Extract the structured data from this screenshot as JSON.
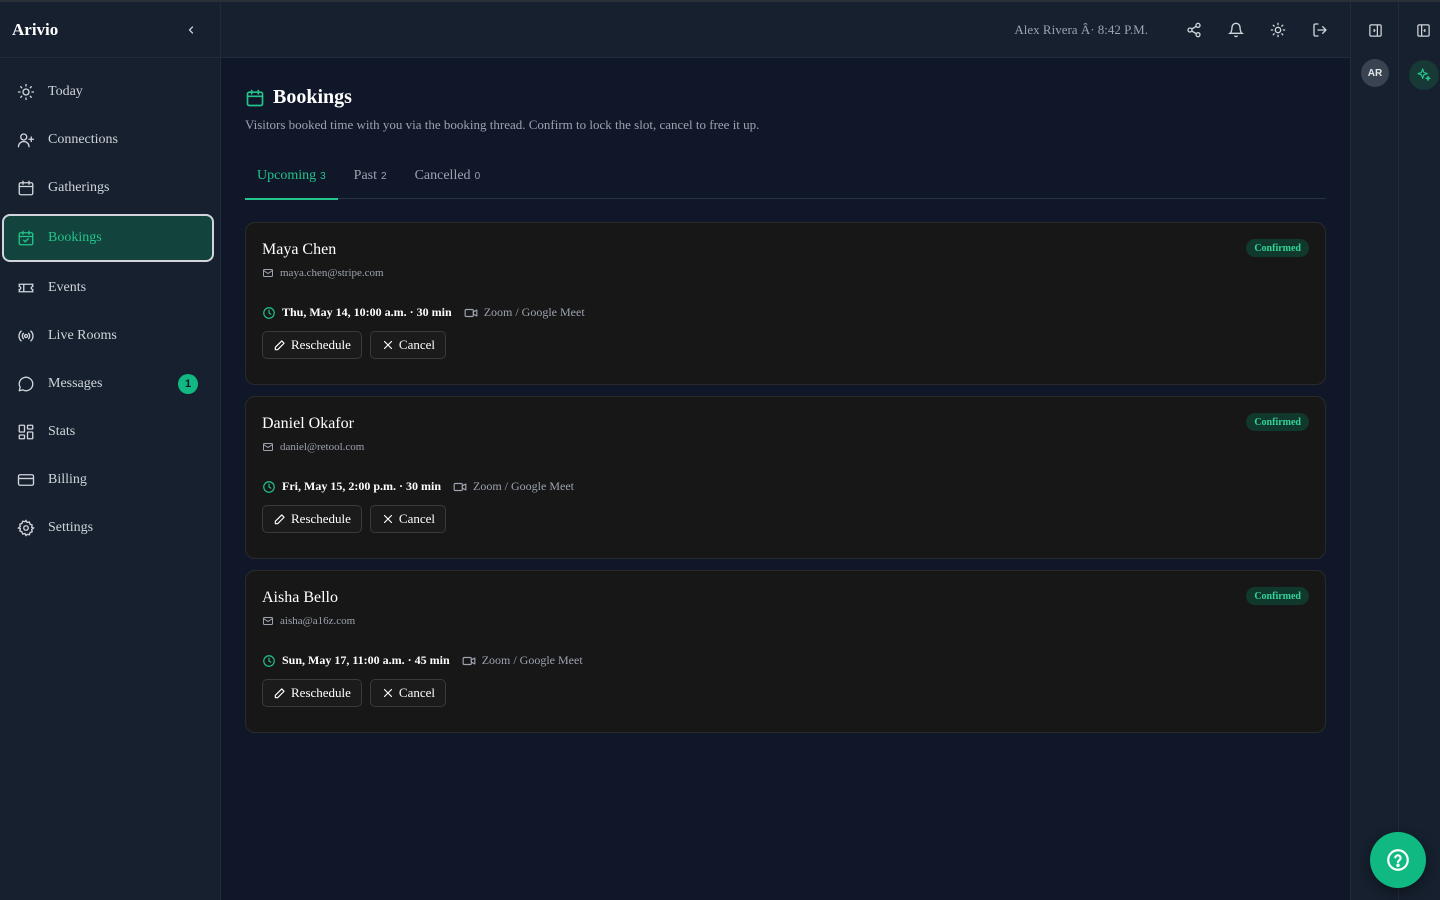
{
  "app": {
    "brand": "Arivio"
  },
  "sidebar": {
    "items": [
      {
        "label": "Today",
        "icon": "sun-icon"
      },
      {
        "label": "Connections",
        "icon": "user-plus-icon"
      },
      {
        "label": "Gatherings",
        "icon": "calendar-icon"
      },
      {
        "label": "Bookings",
        "icon": "calendar-check-icon",
        "active": true
      },
      {
        "label": "Events",
        "icon": "ticket-icon"
      },
      {
        "label": "Live Rooms",
        "icon": "broadcast-icon"
      },
      {
        "label": "Messages",
        "icon": "chat-bubble-icon",
        "badge": "1"
      },
      {
        "label": "Stats",
        "icon": "grid-icon"
      },
      {
        "label": "Billing",
        "icon": "credit-card-icon"
      },
      {
        "label": "Settings",
        "icon": "gear-icon"
      }
    ]
  },
  "topbar": {
    "user_info": "Alex Rivera Â· 8:42 P.M."
  },
  "rail": {
    "avatar_initials": "AR"
  },
  "page": {
    "title": "Bookings",
    "subtitle": "Visitors booked time with you via the booking thread. Confirm to lock the slot, cancel to free it up."
  },
  "tabs": [
    {
      "label": "Upcoming",
      "count": "3",
      "active": true
    },
    {
      "label": "Past",
      "count": "2"
    },
    {
      "label": "Cancelled",
      "count": "0"
    }
  ],
  "bookings": [
    {
      "name": "Maya Chen",
      "email": "maya.chen@stripe.com",
      "status": "Confirmed",
      "time": "Thu, May 14, 10:00 a.m. · 30 min",
      "location": "Zoom / Google Meet",
      "reschedule_label": "Reschedule",
      "cancel_label": "Cancel"
    },
    {
      "name": "Daniel Okafor",
      "email": "daniel@retool.com",
      "status": "Confirmed",
      "time": "Fri, May 15, 2:00 p.m. · 30 min",
      "location": "Zoom / Google Meet",
      "reschedule_label": "Reschedule",
      "cancel_label": "Cancel"
    },
    {
      "name": "Aisha Bello",
      "email": "aisha@a16z.com",
      "status": "Confirmed",
      "time": "Sun, May 17, 11:00 a.m. · 45 min",
      "location": "Zoom / Google Meet",
      "reschedule_label": "Reschedule",
      "cancel_label": "Cancel"
    }
  ],
  "colors": {
    "accent": "#22c58b",
    "background": "#0f1729",
    "card": "#171717",
    "sidebar": "#16202e"
  }
}
